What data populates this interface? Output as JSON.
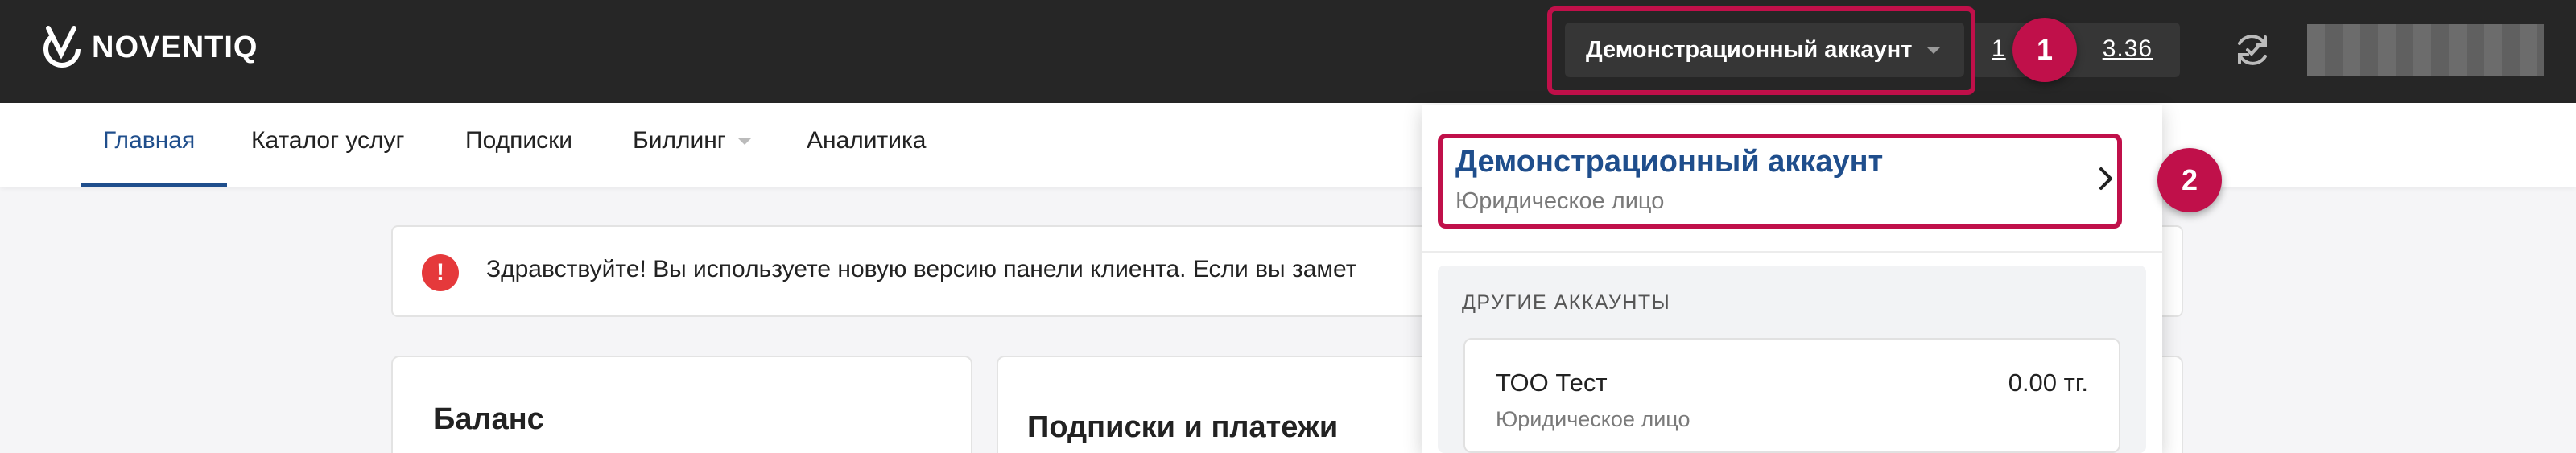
{
  "header": {
    "logo_text": "NOVENTIQ",
    "account_button_label": "Демонстрационный аккаунт",
    "balance_prefix": "1",
    "balance_suffix": "3.36",
    "icons": [
      "noventiq-logo-icon",
      "caret-down-icon",
      "sync-icon"
    ]
  },
  "nav": {
    "items": [
      {
        "label": "Главная"
      },
      {
        "label": "Каталог услуг"
      },
      {
        "label": "Подписки"
      },
      {
        "label": "Биллинг"
      },
      {
        "label": "Аналитика"
      }
    ]
  },
  "alert": {
    "icon": "!",
    "text": "Здравствуйте! Вы используете новую версию панели клиента. Если вы замет"
  },
  "cards": {
    "balance_title": "Баланс",
    "subscriptions_title": "Подписки и платежи"
  },
  "dropdown": {
    "current_account_name": "Демонстрационный аккаунт",
    "current_account_type": "Юридическое лицо",
    "other_accounts_title": "ДРУГИЕ АККАУНТЫ",
    "other_accounts": [
      {
        "name": "ТОО Тест",
        "type": "Юридическое лицо",
        "amount": "0.00 тг."
      }
    ]
  },
  "annotations": {
    "badge_1": "1",
    "badge_2": "2"
  },
  "colors": {
    "header_bg": "#262626",
    "accent_blue": "#1f4e8c",
    "highlight": "#c0104a",
    "alert_red": "#e5393b"
  }
}
